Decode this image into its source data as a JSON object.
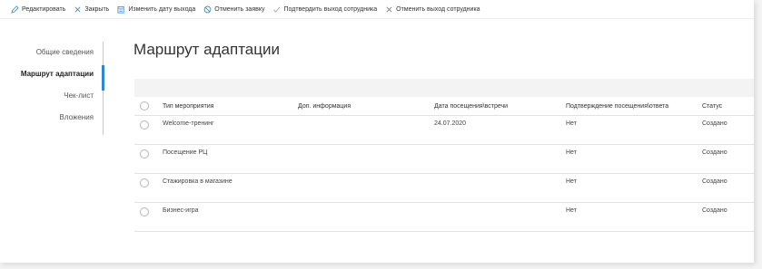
{
  "toolbar": {
    "edit": "Редактировать",
    "close": "Закрыть",
    "change_exit_date": "Изменить дату выхода",
    "cancel_request": "Отменить заявку",
    "confirm_exit": "Подтвердить выход сотрудника",
    "cancel_exit": "Отменить выход сотрудника"
  },
  "nav": {
    "items": [
      {
        "label": "Общие сведения"
      },
      {
        "label": "Маршрут адаптации"
      },
      {
        "label": "Чек-лист"
      },
      {
        "label": "Вложения"
      }
    ],
    "active_index": 1,
    "accent": "#2b88d8"
  },
  "main": {
    "title": "Маршрут адаптации"
  },
  "table": {
    "headers": {
      "type": "Тип мероприятия",
      "info": "Доп. информация",
      "date": "Дата посещения\\встречи",
      "confirm": "Подтверждение посещения\\ответа",
      "status": "Статус"
    },
    "rows": [
      {
        "type": "Welcome-тренинг",
        "info": "",
        "date": "24.07.2020",
        "confirm": "Нет",
        "status": "Создано"
      },
      {
        "type": "Посещение РЦ",
        "info": "",
        "date": "",
        "confirm": "Нет",
        "status": "Создано"
      },
      {
        "type": "Стажировка в магазине",
        "info": "",
        "date": "",
        "confirm": "Нет",
        "status": "Создано"
      },
      {
        "type": "Бизнес-игра",
        "info": "",
        "date": "",
        "confirm": "Нет",
        "status": "Создано"
      }
    ]
  },
  "icons": {
    "edit": "pencil-icon",
    "close": "close-icon",
    "change_exit_date": "calendar-edit-icon",
    "cancel_request": "cancel-icon",
    "confirm_exit": "checkmark-icon",
    "cancel_exit": "close-icon"
  }
}
